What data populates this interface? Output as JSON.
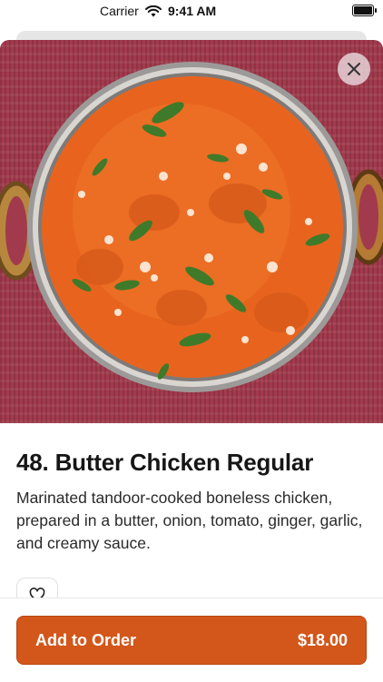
{
  "status_bar": {
    "carrier": "Carrier",
    "time": "9:41 AM"
  },
  "item": {
    "title": "48. Butter Chicken Regular",
    "description": "Marinated tandoor-cooked boneless chicken, prepared in a butter, onion, tomato, ginger, garlic, and creamy sauce."
  },
  "actions": {
    "add_to_order_label": "Add to Order",
    "price": "$18.00"
  },
  "icons": {
    "close": "close-icon",
    "favorite": "heart-icon",
    "wifi": "wifi-icon",
    "battery": "battery-icon"
  },
  "colors": {
    "accent": "#d3561a",
    "placemat": "#a23a4d",
    "curry": "#e8641e"
  }
}
